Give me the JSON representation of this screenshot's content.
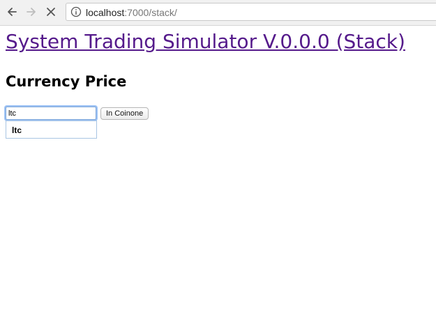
{
  "browser": {
    "url_host": "localhost",
    "url_path": ":7000/stack/"
  },
  "page": {
    "title": "System Trading Simulator V.0.0.0 (Stack)",
    "section_title": "Currency Price"
  },
  "form": {
    "currency_value": "ltc",
    "button_label": "In Coinone",
    "suggestions": [
      "ltc"
    ]
  }
}
